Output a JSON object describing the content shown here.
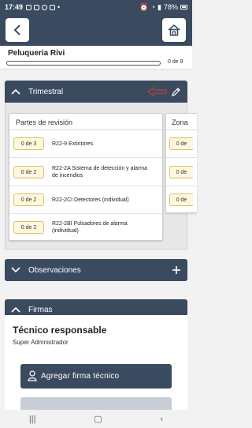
{
  "status_bar": {
    "time": "17:49",
    "battery": "78%"
  },
  "app_bar": {
    "back_icon": "chevron-left-icon",
    "home_icon": "home-icon"
  },
  "header": {
    "title": "Peluqueria Rivi",
    "progress_label": "0 de 9",
    "progress_fraction": 0
  },
  "section_trimestral": {
    "title": "Trimestral",
    "edit_icon": "pencil-icon",
    "annotation_color": "#d33c3c",
    "cards": [
      {
        "title": "Partes de revisión",
        "rows": [
          {
            "count": "0 de 3",
            "label": "R22-9 Extintores"
          },
          {
            "count": "0 de 2",
            "label": "R22-2A Sistema de detección y alarma de incendios"
          },
          {
            "count": "0 de 2",
            "label": "R22-2CI Detectores (individual)"
          },
          {
            "count": "0 de 2",
            "label": "R22-2BI Pulsadores de alarma (individual)"
          }
        ]
      },
      {
        "title": "Zona",
        "rows": [
          {
            "count": "0 de"
          },
          {
            "count": "0 de"
          },
          {
            "count": "0 de"
          }
        ]
      }
    ]
  },
  "section_observaciones": {
    "title": "Observaciones",
    "add_icon": "plus-icon"
  },
  "section_firmas": {
    "title": "Firmas",
    "role": "Técnico responsable",
    "name": "Super Admnistrador",
    "button_label": "Agregar firma técnico"
  },
  "colors": {
    "primary": "#3b4b5f",
    "pill_border": "#d9c06a",
    "pill_bg": "#fff7dd"
  }
}
